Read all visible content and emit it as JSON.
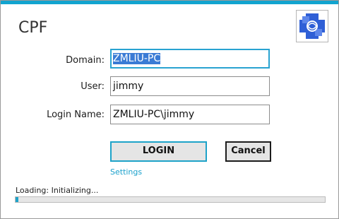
{
  "app": {
    "title": "CPF",
    "logo_icon": "app-logo-icon"
  },
  "form": {
    "domain_label": "Domain:",
    "domain_value": "ZMLIU-PC",
    "user_label": "User:",
    "user_value": "jimmy",
    "login_name_label": "Login Name:",
    "login_name_value": "ZMLIU-PC\\jimmy"
  },
  "actions": {
    "login_label": "LOGIN",
    "cancel_label": "Cancel",
    "settings_label": "Settings"
  },
  "status": {
    "text": "Loading: Initializing...",
    "progress_percent": 1
  },
  "colors": {
    "accent": "#12a4cf",
    "selection": "#3a7bd5",
    "logo_blue": "#2f5fd6"
  }
}
